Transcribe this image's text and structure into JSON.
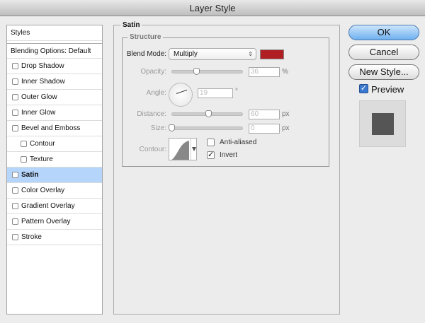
{
  "title": "Layer Style",
  "sidebar": {
    "items": [
      {
        "label": "Styles"
      },
      {
        "label": "Blending Options: Default"
      },
      {
        "label": "Drop Shadow",
        "checked": false
      },
      {
        "label": "Inner Shadow",
        "checked": false
      },
      {
        "label": "Outer Glow",
        "checked": false
      },
      {
        "label": "Inner Glow",
        "checked": false
      },
      {
        "label": "Bevel and Emboss",
        "checked": false
      },
      {
        "label": "Contour",
        "checked": false
      },
      {
        "label": "Texture",
        "checked": false
      },
      {
        "label": "Satin",
        "checked": false,
        "selected": true
      },
      {
        "label": "Color Overlay",
        "checked": false
      },
      {
        "label": "Gradient Overlay",
        "checked": false
      },
      {
        "label": "Pattern Overlay",
        "checked": false
      },
      {
        "label": "Stroke",
        "checked": false
      }
    ]
  },
  "satin": {
    "title": "Satin",
    "structure": "Structure",
    "blend_mode_label": "Blend Mode:",
    "blend_mode": "Multiply",
    "color": "#b02022",
    "opacity_label": "Opacity:",
    "opacity": "36",
    "opacity_unit": "%",
    "angle_label": "Angle:",
    "angle": "19",
    "angle_unit": "°",
    "distance_label": "Distance:",
    "distance": "60",
    "distance_unit": "px",
    "size_label": "Size:",
    "size": "0",
    "size_unit": "px",
    "contour_label": "Contour:",
    "anti_aliased_label": "Anti-aliased",
    "anti_aliased": false,
    "invert_label": "Invert",
    "invert": true
  },
  "buttons": {
    "ok": "OK",
    "cancel": "Cancel",
    "new_style": "New Style..."
  },
  "preview": {
    "label": "Preview",
    "checked": true
  }
}
